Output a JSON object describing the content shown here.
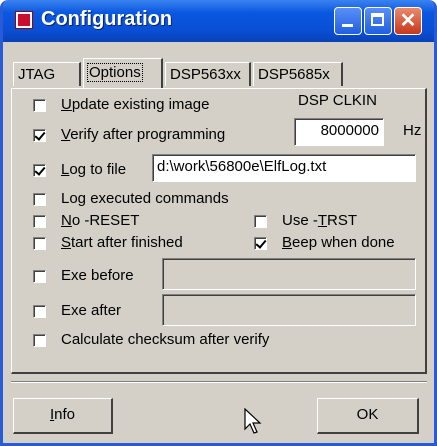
{
  "window": {
    "title": "Configuration",
    "controls": {
      "minimize": "minimize",
      "maximize": "maximize",
      "close": "✕"
    }
  },
  "tabs": [
    {
      "label": "JTAG",
      "active": false
    },
    {
      "label": "Options",
      "active": true
    },
    {
      "label": "DSP563xx",
      "active": false
    },
    {
      "label": "DSP5685x",
      "active": false
    }
  ],
  "options": {
    "update_existing_image": {
      "label": "Update existing image",
      "checked": false
    },
    "verify_after_programming": {
      "label": "Verify after programming",
      "checked": true
    },
    "log_to_file": {
      "label": "Log to file",
      "checked": true,
      "value": "d:\\work\\56800e\\ElfLog.txt"
    },
    "log_executed_commands": {
      "label": "Log executed commands",
      "checked": false
    },
    "no_reset": {
      "label": "No -RESET",
      "checked": false
    },
    "use_trst": {
      "label": "Use -TRST",
      "checked": false
    },
    "start_after_finished": {
      "label": "Start after finished",
      "checked": false
    },
    "beep_when_done": {
      "label": "Beep when done",
      "checked": true
    },
    "exe_before": {
      "label": "Exe before",
      "checked": false,
      "value": ""
    },
    "exe_after": {
      "label": "Exe after",
      "checked": false,
      "value": ""
    },
    "calculate_checksum": {
      "label": "Calculate checksum after verify",
      "checked": false
    }
  },
  "dsp_clkin": {
    "label": "DSP CLKIN",
    "value": "8000000",
    "unit": "Hz"
  },
  "buttons": {
    "info": "Info",
    "ok": "OK"
  },
  "colors": {
    "titlebar": "#0a4fd6",
    "face": "#d4d0c8",
    "close": "#c6391a"
  }
}
